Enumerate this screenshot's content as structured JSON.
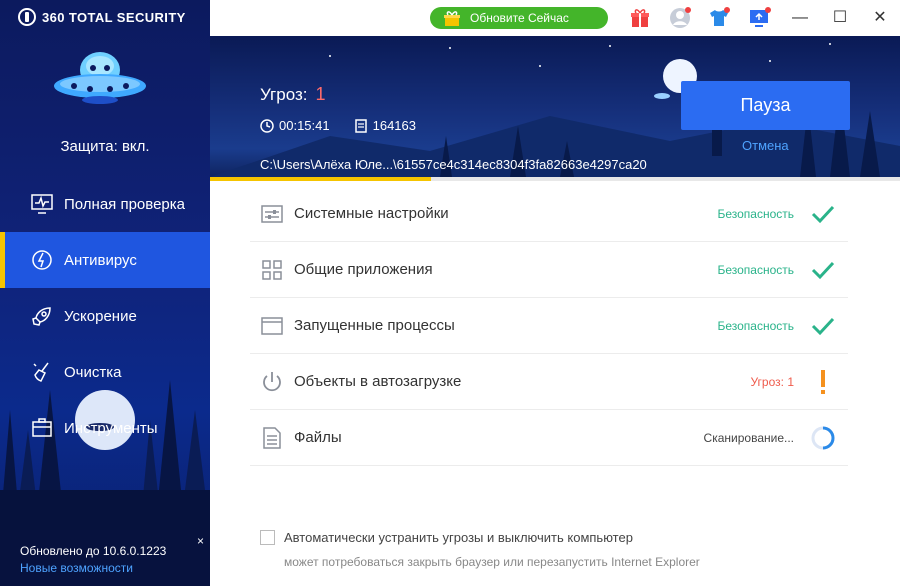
{
  "app": {
    "brand": "360 TOTAL SECURITY",
    "protection": "Защита: вкл."
  },
  "sidebar": {
    "items": [
      {
        "label": "Полная проверка",
        "icon": "monitor-pulse-icon",
        "active": false
      },
      {
        "label": "Антивирус",
        "icon": "bolt-shield-icon",
        "active": true
      },
      {
        "label": "Ускорение",
        "icon": "rocket-icon",
        "active": false
      },
      {
        "label": "Очистка",
        "icon": "broom-icon",
        "active": false
      },
      {
        "label": "Инструменты",
        "icon": "toolbox-icon",
        "active": false
      }
    ]
  },
  "update": {
    "version_text": "Обновлено до 10.6.0.1223",
    "link": "Новые возможности",
    "close": "×"
  },
  "topbar": {
    "update_button": "Обновите Сейчас",
    "window": {
      "minimize": "—",
      "maximize": "☐",
      "close": "✕"
    }
  },
  "scan": {
    "threats_label": "Угроз:",
    "threats_count": "1",
    "elapsed": "00:15:41",
    "files_count": "164163",
    "current_path": "C:\\Users\\Алёха Юле...\\61557ce4c314ec8304f3fa82663e4297ca20",
    "pause": "Пауза",
    "cancel": "Отмена",
    "progress": 0.32
  },
  "items": [
    {
      "label": "Системные настройки",
      "status": "Безопасность",
      "state": "ok",
      "icon": "settings-sliders-icon"
    },
    {
      "label": "Общие приложения",
      "status": "Безопасность",
      "state": "ok",
      "icon": "app-grid-icon"
    },
    {
      "label": "Запущенные процессы",
      "status": "Безопасность",
      "state": "ok",
      "icon": "window-icon"
    },
    {
      "label": "Объекты в автозагрузке",
      "status": "Угроз: 1",
      "state": "warn",
      "icon": "power-icon"
    },
    {
      "label": "Файлы",
      "status": "Сканирование...",
      "state": "scan",
      "icon": "document-icon"
    }
  ],
  "footer": {
    "auto_fix": "Автоматически устранить угрозы и выключить компьютер",
    "note": "может потребоваться закрыть браузер или перезапустить Internet Explorer"
  },
  "colors": {
    "accent": "#2b6cf2",
    "safe": "#2ab38a",
    "warn": "#ef5b4c",
    "progress": "#f5c400",
    "sidebar_active": "#1f56e0"
  }
}
